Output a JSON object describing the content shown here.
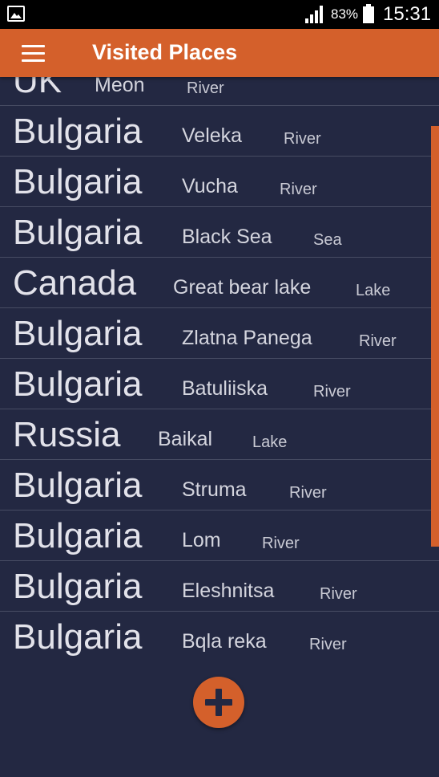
{
  "status_bar": {
    "battery_percent": "83%",
    "time": "15:31",
    "icons": [
      "gallery-icon",
      "signal-icon",
      "battery-icon"
    ]
  },
  "app_bar": {
    "title": "Visited Places",
    "menu_icon": "hamburger-menu-icon",
    "color": "#d4602b"
  },
  "places": [
    {
      "country": "UK",
      "place": "Meon",
      "type": "River"
    },
    {
      "country": "Bulgaria",
      "place": "Veleka",
      "type": "River"
    },
    {
      "country": "Bulgaria",
      "place": "Vucha",
      "type": "River"
    },
    {
      "country": "Bulgaria",
      "place": "Black Sea",
      "type": "Sea"
    },
    {
      "country": "Canada",
      "place": "Great bear lake",
      "type": "Lake"
    },
    {
      "country": "Bulgaria",
      "place": "Zlatna Panega",
      "type": "River"
    },
    {
      "country": "Bulgaria",
      "place": "Batuliiska",
      "type": "River"
    },
    {
      "country": "Russia",
      "place": "Baikal",
      "type": "Lake"
    },
    {
      "country": "Bulgaria",
      "place": "Struma",
      "type": "River"
    },
    {
      "country": "Bulgaria",
      "place": "Lom",
      "type": "River"
    },
    {
      "country": "Bulgaria",
      "place": "Eleshnitsa",
      "type": "River"
    },
    {
      "country": "Bulgaria",
      "place": "Bqla reka",
      "type": "River"
    }
  ],
  "fab": {
    "icon": "plus-icon"
  },
  "colors": {
    "background": "#232842",
    "accent": "#d4602b",
    "divider": "#474c63",
    "text": "#e2e2ea"
  }
}
